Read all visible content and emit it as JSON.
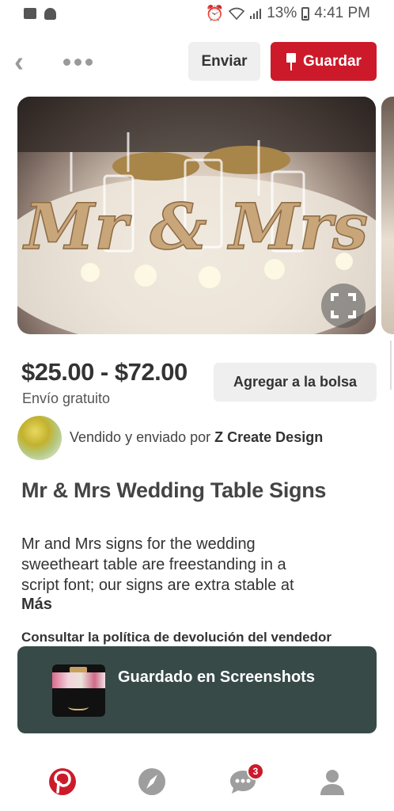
{
  "status_bar": {
    "battery": "13%",
    "time": "4:41 PM",
    "icons": [
      "gallery-icon",
      "snapchat-icon",
      "alarm-icon",
      "wifi-icon",
      "signal-icon",
      "battery-icon"
    ]
  },
  "header": {
    "send_label": "Enviar",
    "save_label": "Guardar",
    "icons": [
      "back-arrow-icon",
      "more-options-icon",
      "pin-icon"
    ]
  },
  "pin": {
    "image_alt": "Mr & Mrs",
    "price": "$25.00 - $72.00",
    "shipping": "Envío gratuito",
    "add_to_bag_label": "Agregar a la bolsa",
    "seller_prefix": "Vendido y enviado por",
    "seller_name": "Z Create Design",
    "title": "Mr & Mrs Wedding Table Signs",
    "description": "Mr and Mrs signs for the wedding sweetheart table are freestanding in a script font; our signs are extra stable at",
    "more_label": "Más",
    "return_policy": "Consultar la política de devolución del vendedor"
  },
  "toast": {
    "message": "Guardado en Screenshots"
  },
  "bottom_nav": {
    "items": [
      "home-icon",
      "explore-icon",
      "messages-icon",
      "profile-icon"
    ],
    "messages_badge": "3"
  },
  "colors": {
    "accent": "#cc1a2a",
    "toast_bg": "#374a48",
    "button_gray": "#efefef"
  }
}
